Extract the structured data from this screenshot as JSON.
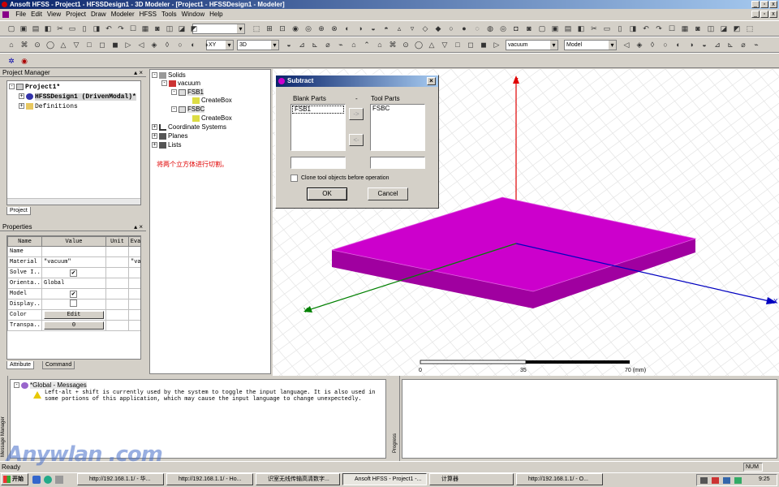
{
  "window": {
    "title": "Ansoft HFSS - Project1 - HFSSDesign1 - 3D Modeler - [Project1 - HFSSDesign1 - Modeler]"
  },
  "menu": [
    "File",
    "Edit",
    "View",
    "Project",
    "Draw",
    "Modeler",
    "HFSS",
    "Tools",
    "Window",
    "Help"
  ],
  "toolbar": {
    "plane": "XY",
    "view": "3D",
    "material": "vacuum",
    "mode": "Model"
  },
  "project_manager": {
    "header": "Project Manager",
    "project": "Project1*",
    "design": "HFSSDesign1 (DrivenModal)*",
    "definitions": "Definitions",
    "tab": "Project"
  },
  "history_tree": {
    "solids": "Solids",
    "vacuum": "vacuum",
    "obj1": "FSB1",
    "op1": "CreateBox",
    "obj2": "FSBC",
    "op2": "CreateBox",
    "coords": "Coordinate Systems",
    "planes": "Planes",
    "lists": "Lists",
    "note": "将两个立方体进行切割。"
  },
  "properties": {
    "header": "Properties",
    "columns": [
      "Name",
      "Value",
      "Unit",
      "Eva"
    ],
    "rows": [
      {
        "name": "Name",
        "value": "",
        "unit": "",
        "eva": ""
      },
      {
        "name": "Material",
        "value": "\"vacuum\"",
        "unit": "",
        "eva": "\"va"
      },
      {
        "name": "Solve I...",
        "value": "✔",
        "unit": "",
        "eva": ""
      },
      {
        "name": "Orienta...",
        "value": "Global",
        "unit": "",
        "eva": ""
      },
      {
        "name": "Model",
        "value": "✔",
        "unit": "",
        "eva": ""
      },
      {
        "name": "Display...",
        "value": "",
        "unit": "",
        "eva": ""
      },
      {
        "name": "Color",
        "value": "Edit",
        "unit": "",
        "eva": ""
      },
      {
        "name": "Transpa...",
        "value": "0",
        "unit": "",
        "eva": ""
      }
    ],
    "tabs": [
      "Attribute",
      "Command"
    ]
  },
  "dialog": {
    "title": "Subtract",
    "blank_label": "Blank Parts",
    "tool_label": "Tool Parts",
    "blank_items": [
      "FSB1"
    ],
    "tool_items": [
      "FSBC"
    ],
    "move_right": "->",
    "move_left": "<-",
    "dash": "-",
    "clone_label": "Clone tool objects before operation",
    "ok": "OK",
    "cancel": "Cancel"
  },
  "viewport": {
    "axis_z": "Z",
    "axis_y": "Y",
    "axis_x": "X",
    "scale_labels": [
      "0",
      "35",
      "70 (mm)"
    ],
    "box_color": "#c000c0"
  },
  "messages": {
    "header": "*Global - Messages",
    "text": "Left-alt + shift is currently used by the system to toggle the input language. It is also used in some portions of this application, which may cause the input language to change unexpectedly.",
    "side_label": "Message Manager",
    "progress_label": "Progress"
  },
  "status": {
    "ready": "Ready",
    "num": "NUM"
  },
  "watermark": "Anywlan .com",
  "taskbar": {
    "start": "开始",
    "buttons": [
      "http://192.168.1.1/ - 华...",
      "http://192.168.1.1/ - Ho...",
      "识室无线传输高清数字...",
      "Ansoft HFSS - Project1 -...",
      "计算器",
      "http://192.168.1.1/ - O..."
    ],
    "clock": "9:25"
  }
}
